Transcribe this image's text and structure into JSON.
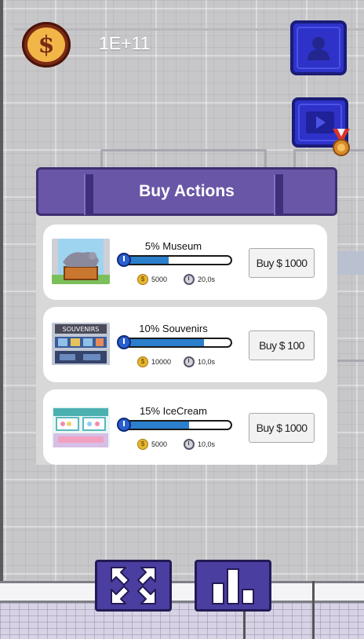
{
  "hud": {
    "currency_symbol": "$",
    "money": "1E+11",
    "icons": [
      "coin-icon",
      "profile-icon",
      "video-ad-icon",
      "medal-icon"
    ]
  },
  "panel": {
    "title": "Buy Actions",
    "items": [
      {
        "label": "5% Museum",
        "progress": 0.42,
        "price_label": "Buy $ 1000",
        "reward": "5000",
        "time": "20,0s",
        "thumb": "museum-thumbnail"
      },
      {
        "label": "10% Souvenirs",
        "progress": 0.75,
        "price_label": "Buy $ 100",
        "reward": "10000",
        "time": "10,0s",
        "thumb": "souvenirs-thumbnail",
        "thumb_sign": "SOUVENIRS"
      },
      {
        "label": "15% IceCream",
        "progress": 0.61,
        "price_label": "Buy $ 1000",
        "reward": "5000",
        "time": "10,0s",
        "thumb": "icecream-thumbnail"
      }
    ]
  },
  "bottom_buttons": [
    "expand-icon",
    "stats-icon"
  ],
  "colors": {
    "panel_header": "#6a56a6",
    "button_blue": "#2e32c8",
    "progress_fill": "#2b7fcc",
    "coin_gold": "#f2b648"
  }
}
